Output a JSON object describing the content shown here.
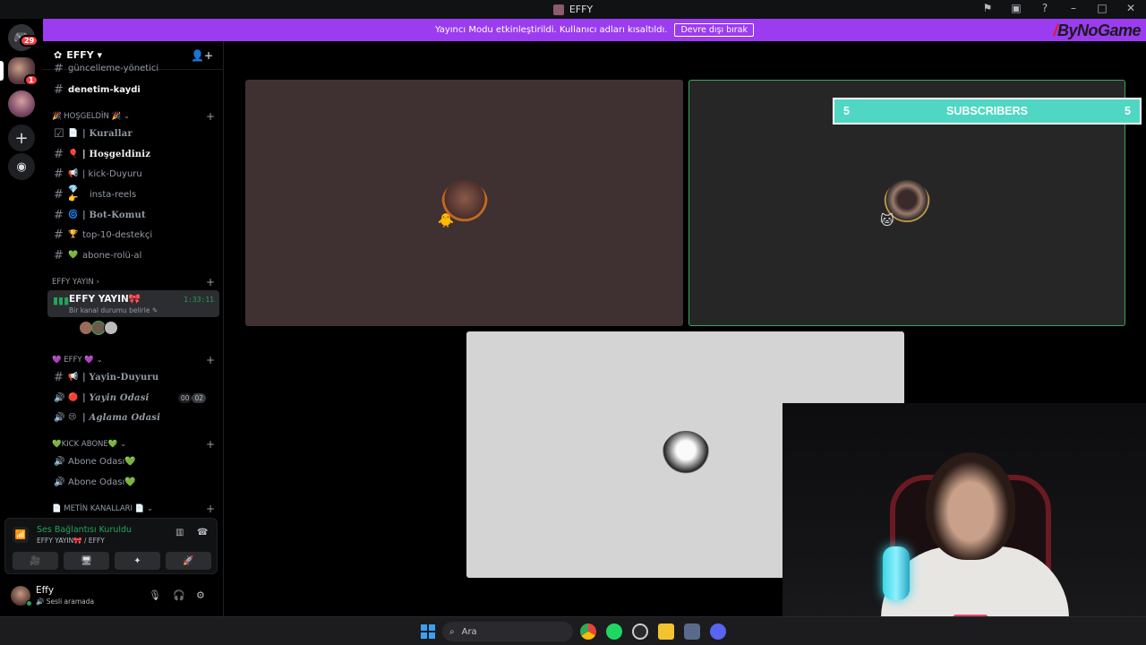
{
  "window": {
    "title": "EFFY",
    "controls": [
      "⚑",
      "▣",
      "?",
      "–",
      "□",
      "✕"
    ]
  },
  "banner": {
    "message": "Yayıncı Modu etkinleştirildi. Kullanıcı adları kısaltıldı.",
    "button": "Devre dışı bırak"
  },
  "brand": {
    "slash": "/",
    "text": "ByNoGame"
  },
  "servers": {
    "dm_badge": "29",
    "server_badge": "1"
  },
  "server": {
    "name": "EFFY ▾",
    "invite_icon": "👤+"
  },
  "channels": {
    "top_clipped": "güncelleme-yönetici",
    "denetim": "denetim-kaydi",
    "cat_hosgeldin": "🎉 HOŞGELDİN 🎉 ⌄",
    "hosgeldin_items": [
      {
        "emoji": "📄",
        "label": "| Kurallar"
      },
      {
        "emoji": "🎈",
        "label": "| Hoşgeldiniz"
      },
      {
        "emoji": "📢",
        "label": "| kick-Duyuru"
      },
      {
        "emoji": "💎👉",
        "label": "insta-reels"
      },
      {
        "emoji": "🌀",
        "label": "| Bot-Komut"
      },
      {
        "emoji": "🏆",
        "label": "top-10-destekçi"
      },
      {
        "emoji": "💚",
        "label": "abone-rolü-al"
      }
    ],
    "cat_yayin": "EFFY YAYIN ›",
    "voice_active": {
      "name": "EFFY YAYIN🎀",
      "sub": "Bir kanal durumu belirle ✎",
      "timer": "1:33:11"
    },
    "cat_effy": "💜 EFFY 💜 ⌄",
    "effy_items": [
      {
        "icon": "#",
        "emoji": "📢",
        "label": "| Yayin-Duyuru"
      },
      {
        "icon": "🔊",
        "emoji": "🔴",
        "label": "| Yayin Odasi",
        "counter": [
          "00",
          "02"
        ]
      },
      {
        "icon": "🔊",
        "emoji": "😢",
        "label": "| Aglama Odasi"
      }
    ],
    "cat_kick": "💚KICK ABONE💚 ⌄",
    "kick_items": [
      {
        "label": "Abone Odası💚"
      },
      {
        "label": "Abone Odası💚"
      }
    ],
    "cat_metin": "📄 METİN KANALLARI 📄 ⌄"
  },
  "voice_panel": {
    "title": "Ses Bağlantısı Kuruldu",
    "subtitle": "EFFY YAYIN🎀 / EFFY",
    "buttons": [
      "🎥",
      "🖥",
      "✦",
      "🚀"
    ]
  },
  "user": {
    "name": "Effy",
    "status": "🔊 Sesli aramada"
  },
  "overlay": {
    "left": "5",
    "label": "SUBSCRIBERS",
    "right": "5"
  },
  "taskbar": {
    "search": "Ara"
  },
  "colors": {
    "accent": "#9b3cf0",
    "speaking": "#3ba55c",
    "subs": "#4fd7c3"
  }
}
